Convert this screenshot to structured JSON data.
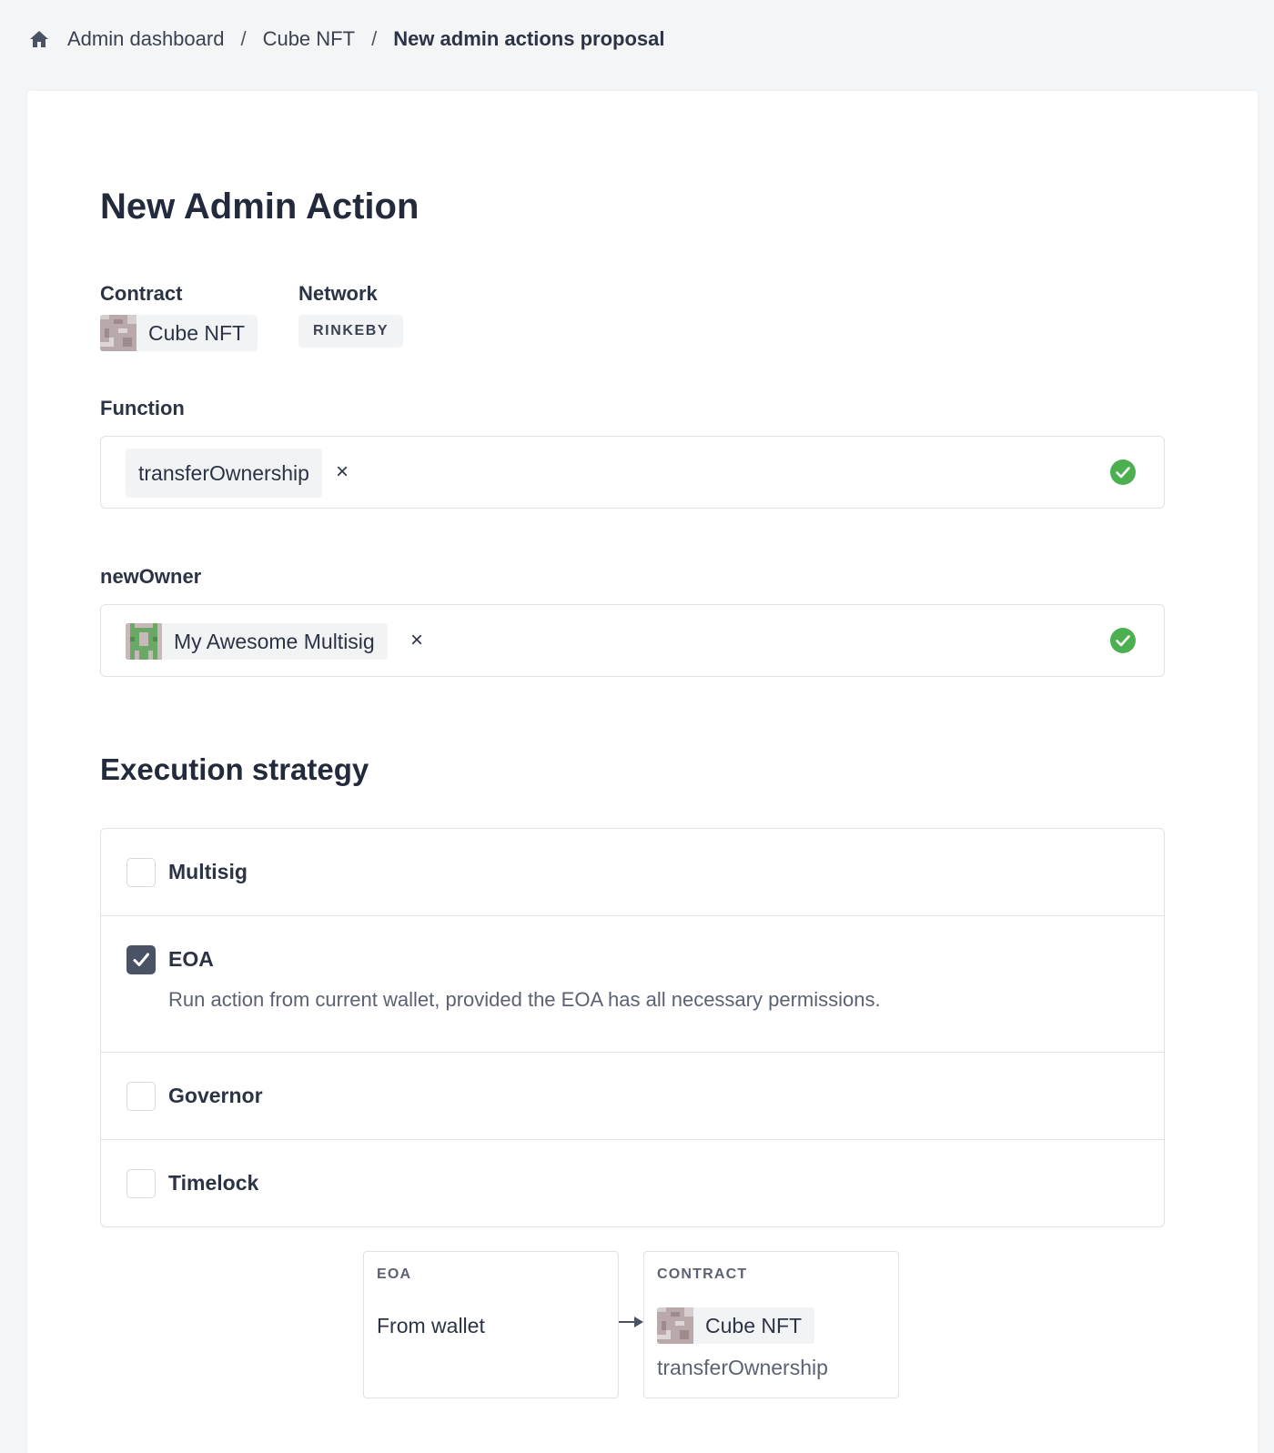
{
  "breadcrumb": {
    "home_icon": "home-icon",
    "items": [
      "Admin dashboard",
      "Cube NFT"
    ],
    "current": "New admin actions proposal",
    "separator": "/"
  },
  "page": {
    "title": "New Admin Action"
  },
  "contract": {
    "label": "Contract",
    "name": "Cube NFT"
  },
  "network": {
    "label": "Network",
    "value": "RINKEBY"
  },
  "function": {
    "label": "Function",
    "value": "transferOwnership",
    "clear": "×",
    "valid_icon": "check-circle-icon"
  },
  "new_owner": {
    "label": "newOwner",
    "value": "My Awesome Multisig",
    "clear": "×",
    "valid_icon": "check-circle-icon"
  },
  "execution": {
    "title": "Execution strategy",
    "options": [
      {
        "label": "Multisig",
        "checked": false
      },
      {
        "label": "EOA",
        "checked": true,
        "description": "Run action from current wallet, provided the EOA has all necessary permissions."
      },
      {
        "label": "Governor",
        "checked": false
      },
      {
        "label": "Timelock",
        "checked": false
      }
    ]
  },
  "flow": {
    "source": {
      "heading": "EOA",
      "text": "From wallet"
    },
    "target": {
      "heading": "CONTRACT",
      "name": "Cube NFT",
      "function": "transferOwnership"
    }
  },
  "colors": {
    "valid": "#4caf50",
    "checkbox_checked": "#4a5266",
    "accent_text": "#2c3345"
  }
}
